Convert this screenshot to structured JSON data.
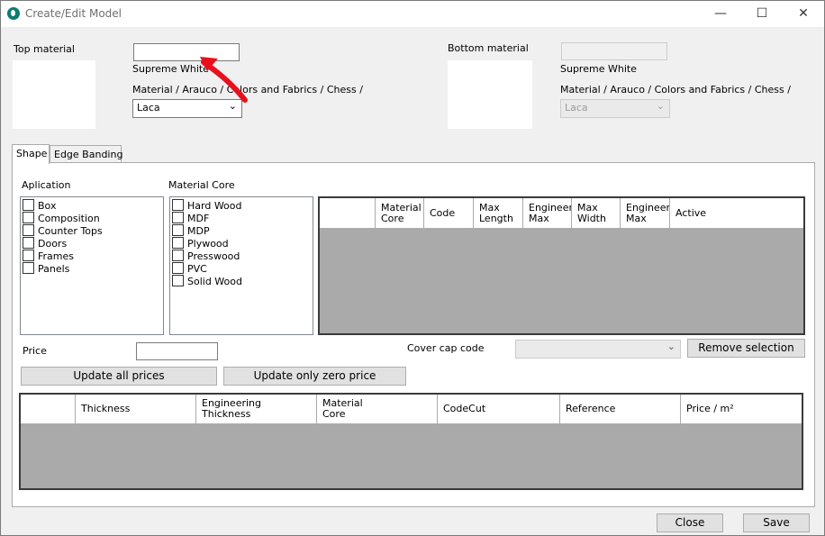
{
  "window": {
    "title": "Create/Edit Model",
    "minimize_icon": "minimize-icon",
    "maximize_icon": "maximize-icon",
    "close_icon": "close-icon"
  },
  "top": {
    "label": "Top material",
    "input_value": "",
    "material_name": "Supreme White",
    "path": "Material  / Arauco / Colors and Fabrics / Chess /",
    "finish": "Laca"
  },
  "bottom": {
    "label": "Bottom material",
    "input_value": "",
    "material_name": "Supreme White",
    "path": "Material  / Arauco / Colors and Fabrics / Chess /",
    "finish": "Laca"
  },
  "tabs": [
    {
      "label": "Shape",
      "active": true
    },
    {
      "label": "Edge Banding",
      "active": false
    }
  ],
  "application": {
    "label": "Aplication",
    "items": [
      "Box",
      "Composition",
      "Counter Tops",
      "Doors",
      "Frames",
      "Panels"
    ]
  },
  "material_core": {
    "label": "Material Core",
    "items": [
      "Hard Wood",
      "MDF",
      "MDP",
      "Plywood",
      "Presswood",
      "PVC",
      "Solid Wood"
    ]
  },
  "core_grid": {
    "columns": [
      "Material Core",
      "Code",
      "Max Length",
      "Engineering Max",
      "Max Width",
      "Engineering Max",
      "Active"
    ]
  },
  "price": {
    "label": "Price",
    "value": ""
  },
  "cover_cap": {
    "label": "Cover cap code",
    "value": ""
  },
  "buttons": {
    "remove_selection": "Remove selection",
    "update_all": "Update all prices",
    "update_zero": "Update only zero price",
    "close": "Close",
    "save": "Save"
  },
  "price_grid": {
    "columns": [
      "Thickness",
      "Engineering Thickness",
      "Material Core",
      "CodeCut",
      "Reference",
      "Price / m²"
    ]
  },
  "colors": {
    "annotation_arrow": "#e8101c",
    "grid_background": "#aaaaaa"
  }
}
